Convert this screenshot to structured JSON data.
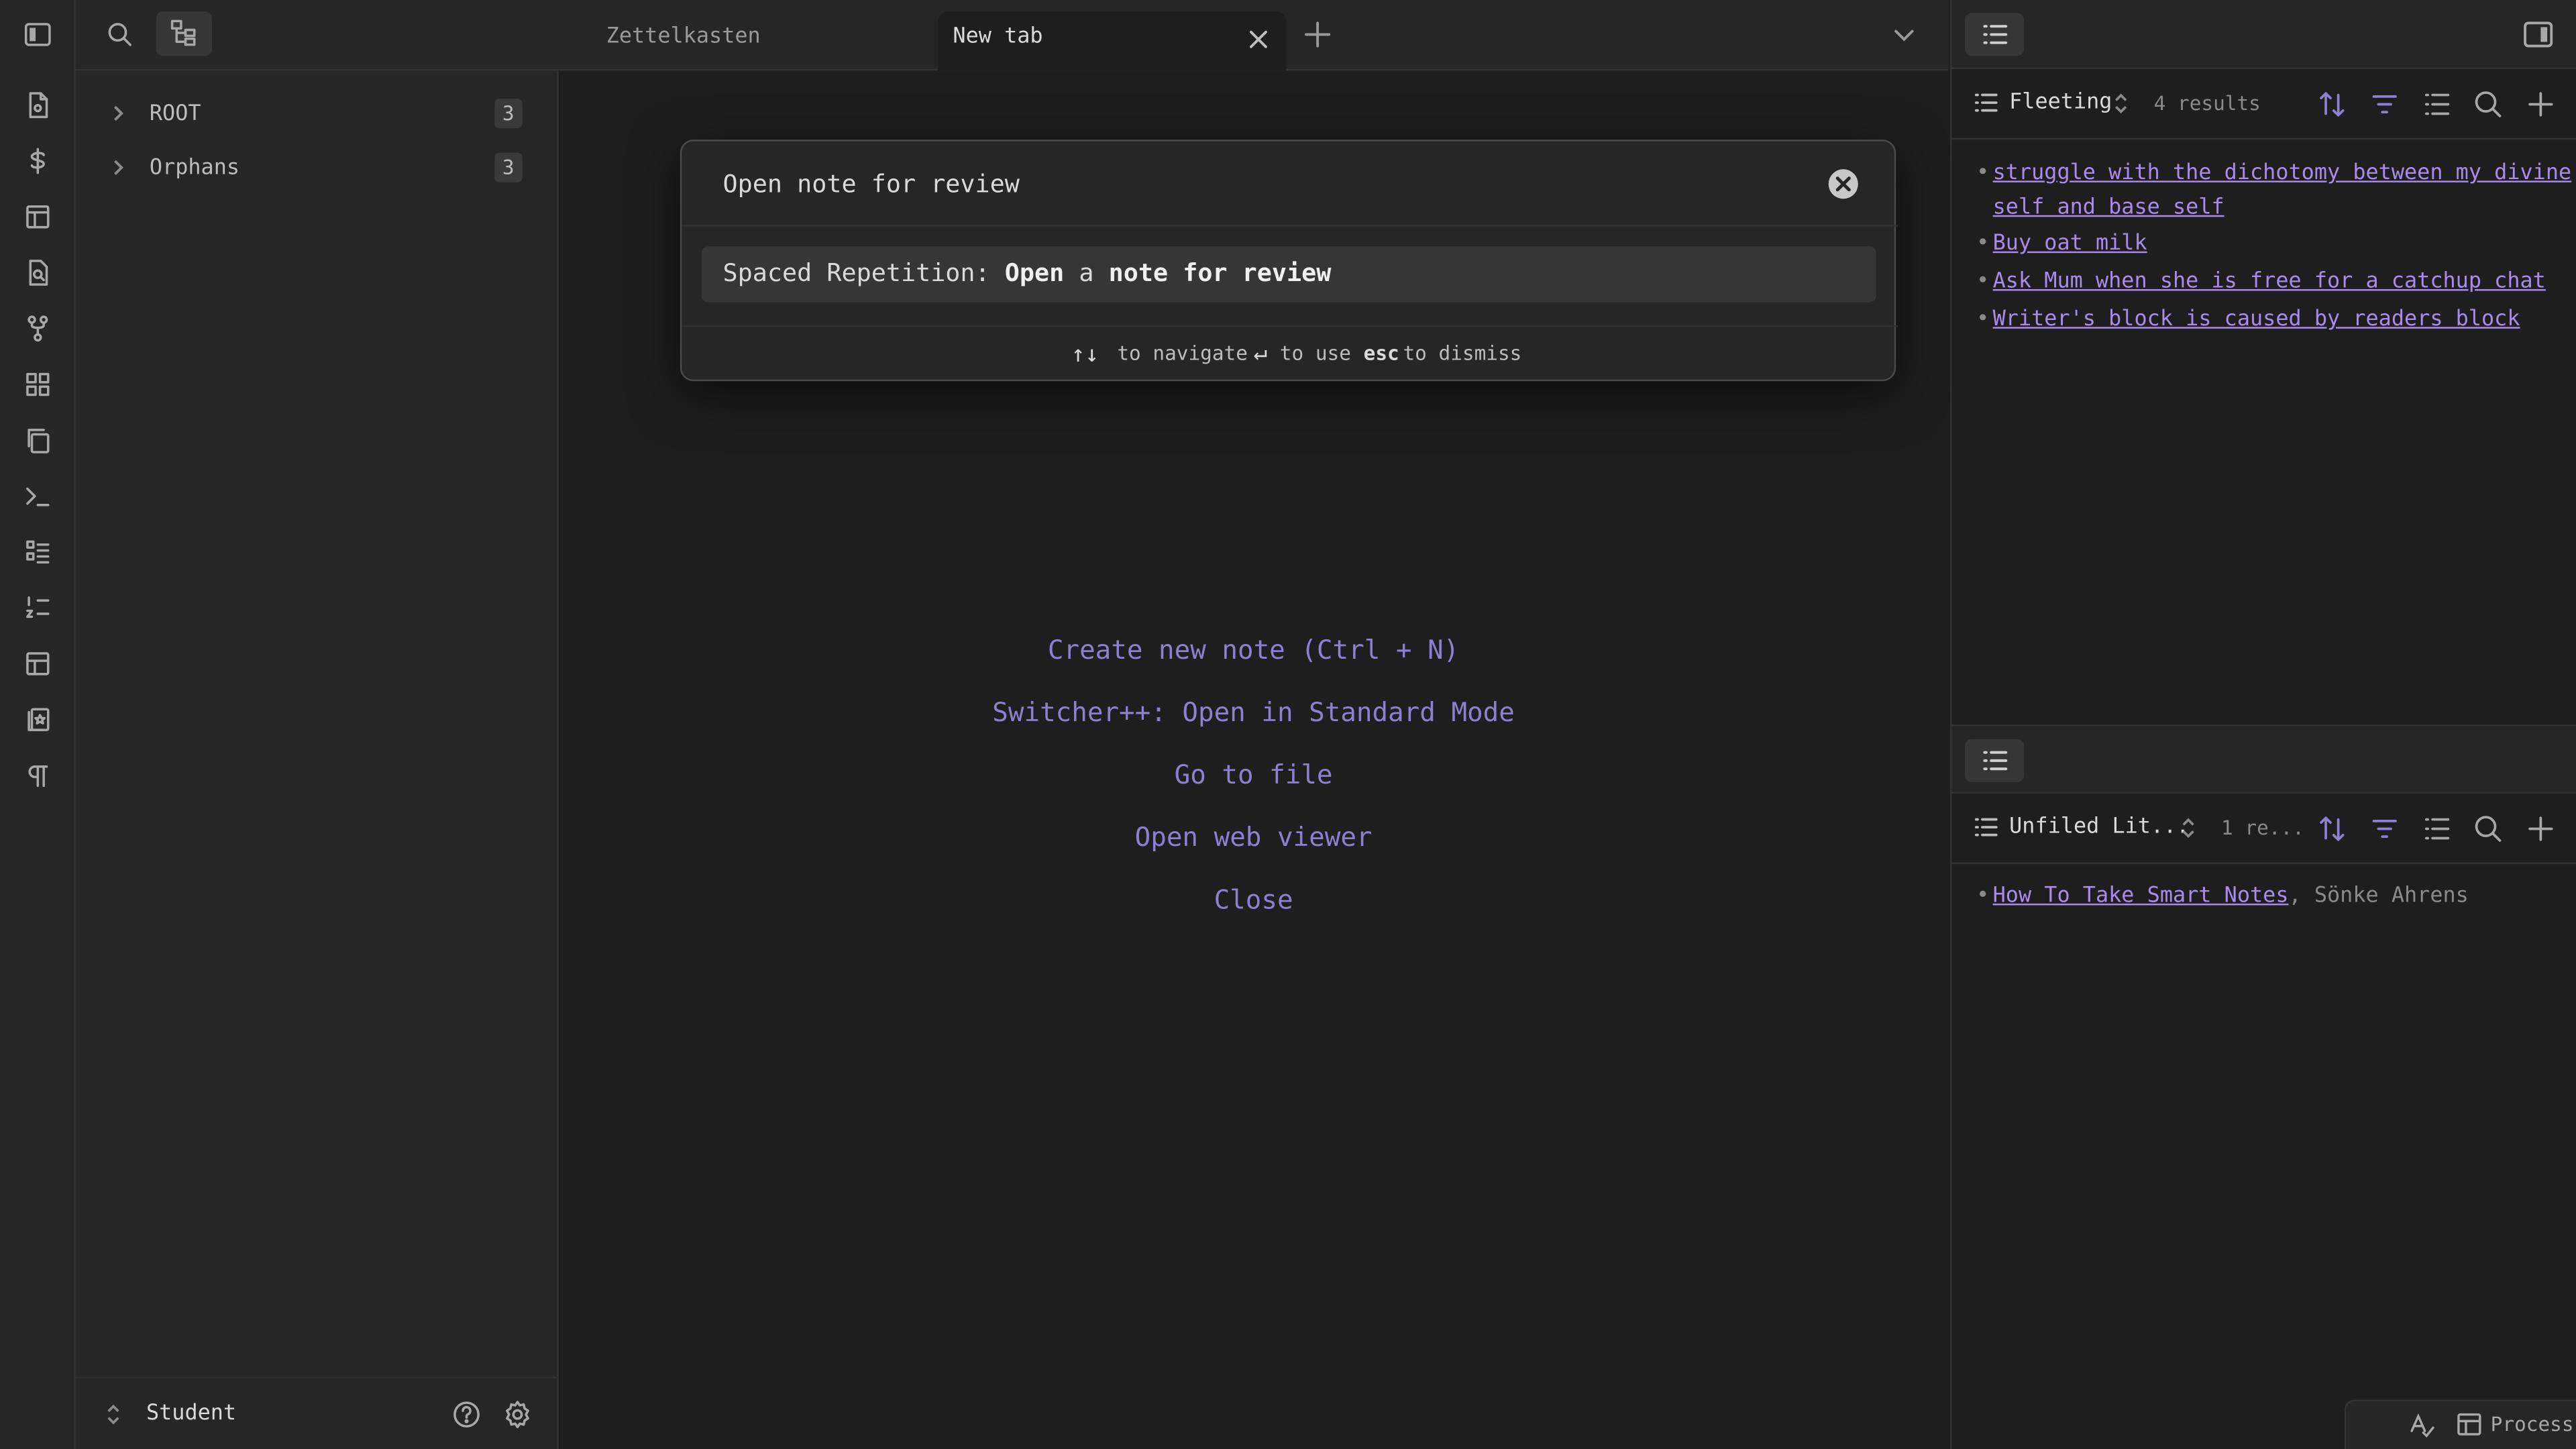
{
  "ribbon": {
    "icons": [
      "sidebar-toggle-icon",
      "open-today-icon",
      "dollar-icon",
      "layout-icon",
      "file-search-icon",
      "git-fork-icon",
      "grid-icon",
      "copy-icon",
      "terminal-icon",
      "list-icon",
      "list-ordered-icon",
      "table-icon",
      "flashcards-icon",
      "pilcrow-icon"
    ]
  },
  "left_sidebar": {
    "tree": [
      {
        "label": "ROOT",
        "count": "3"
      },
      {
        "label": "Orphans",
        "count": "3"
      }
    ],
    "vault_name": "Student"
  },
  "tabs": [
    {
      "label": "Zettelkasten",
      "active": false
    },
    {
      "label": "New tab",
      "active": true
    }
  ],
  "modal": {
    "input_value": "Open note for review",
    "suggestion": {
      "prefix": "Spaced Repetition: ",
      "parts": [
        {
          "text": "Open",
          "bold": true
        },
        {
          "text": " a ",
          "bold": false
        },
        {
          "text": "note",
          "bold": true
        },
        {
          "text": " ",
          "bold": false
        },
        {
          "text": "for",
          "bold": true
        },
        {
          "text": " ",
          "bold": false
        },
        {
          "text": "review",
          "bold": true
        }
      ]
    },
    "instructions": [
      {
        "key": "↑↓",
        "text": "to navigate"
      },
      {
        "key": "↵",
        "text": "to use"
      },
      {
        "key": "esc",
        "text": "to dismiss"
      }
    ]
  },
  "empty_state": {
    "actions": [
      "Create new note (Ctrl + N)",
      "Switcher++: Open in Standard Mode",
      "Go to file",
      "Open web viewer",
      "Close"
    ]
  },
  "right_sidebar": {
    "panel1": {
      "title": "Fleeting",
      "results": "4 results",
      "items": [
        {
          "lines": [
            "struggle with the dichotomy between my divine",
            "self and base self"
          ]
        },
        {
          "lines": [
            "Buy oat milk"
          ]
        },
        {
          "lines": [
            "Ask Mum when she is free for a catchup chat"
          ]
        },
        {
          "lines": [
            "Writer's block is caused by readers block"
          ]
        }
      ]
    },
    "panel2": {
      "title": "Unfiled Lit...",
      "results": "1 re...",
      "items": [
        {
          "link": "How To Take Smart Notes",
          "sep": ",",
          "author": "Sönke Ahrens"
        }
      ]
    }
  },
  "statusbar": {
    "process_label": "Process"
  },
  "colors": {
    "accent": "#8f7fd0",
    "link": "#a88beb",
    "sort_active": "#8f7fd0"
  }
}
